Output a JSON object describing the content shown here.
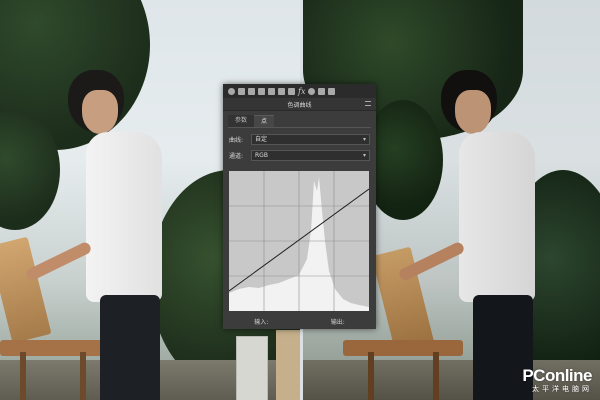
{
  "toolbar": {
    "icons": [
      "adjustment-icon",
      "histogram-icon",
      "levels-icon",
      "brush-icon",
      "layers-icon",
      "channels-icon",
      "paths-icon",
      "fx-icon",
      "camera-icon",
      "properties-icon",
      "clipboard-icon"
    ],
    "fx_glyph": "fx"
  },
  "dialog": {
    "title": "色调曲线",
    "tabs": [
      {
        "label": "参数",
        "active": false
      },
      {
        "label": "点",
        "active": true
      }
    ],
    "curve": {
      "label": "曲线:",
      "value": "自定"
    },
    "channel": {
      "label": "通道:",
      "value": "RGB"
    },
    "input_label": "输入:",
    "output_label": "输出:",
    "colors": {
      "panel": "#3c3c3c",
      "graph_bg": "#c8c8c8",
      "histogram": "#f2f2f2",
      "curve": "#1e1e1e"
    }
  },
  "watermark": {
    "brand": "PConline",
    "subtitle": "太平洋电脑网"
  }
}
